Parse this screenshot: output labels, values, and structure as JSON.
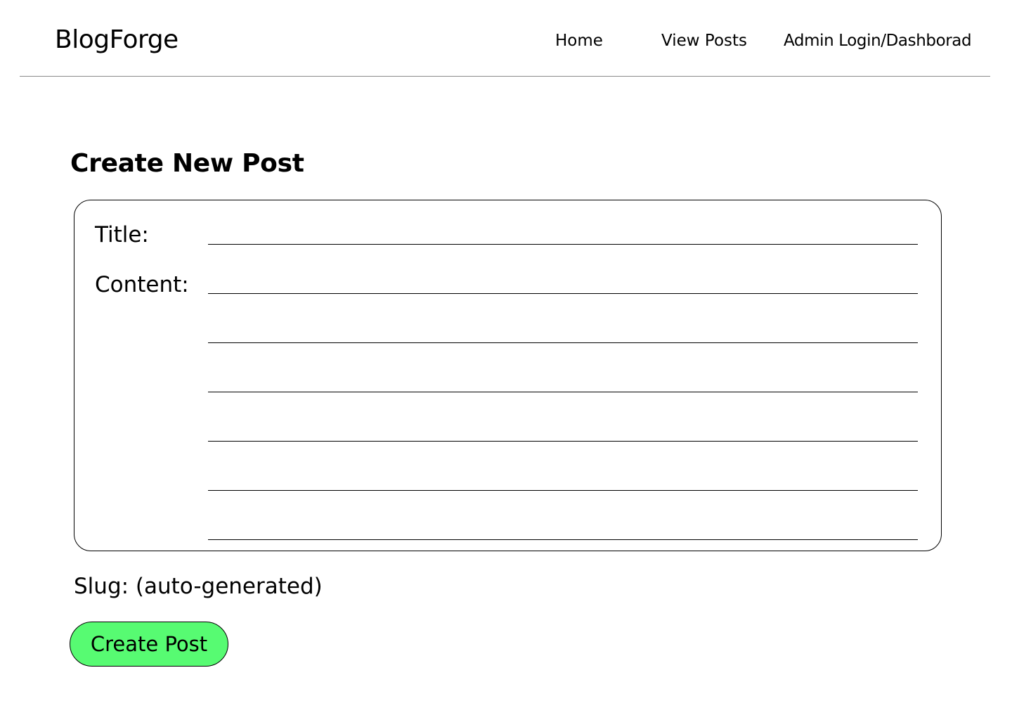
{
  "header": {
    "brand": "BlogForge",
    "nav": {
      "home": "Home",
      "view_posts": "View Posts",
      "admin": "Admin Login/Dashborad"
    }
  },
  "main": {
    "title": "Create New Post",
    "form": {
      "title_label": "Title:",
      "content_label": "Content:",
      "title_value": "",
      "content_value": ""
    },
    "slug_text": "Slug: (auto-generated)",
    "create_button": "Create Post"
  },
  "colors": {
    "button_fill": "#57fb72",
    "divider": "#8a8a8a",
    "text": "#000000"
  }
}
